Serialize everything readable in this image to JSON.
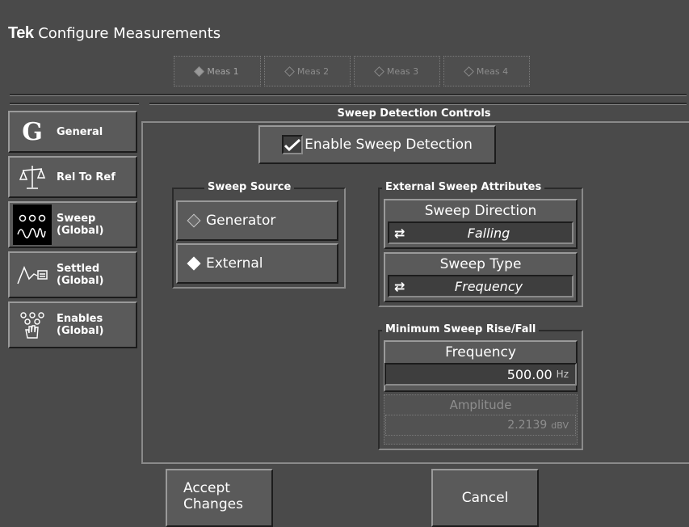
{
  "window": {
    "brand": "Tek",
    "title": "Configure Measurements"
  },
  "meas_tabs": [
    {
      "label": "Meas 1",
      "active": true
    },
    {
      "label": "Meas 2",
      "active": false
    },
    {
      "label": "Meas 3",
      "active": false
    },
    {
      "label": "Meas 4",
      "active": false
    }
  ],
  "section_title": "Sweep Detection Controls",
  "sidebar": {
    "items": [
      {
        "label": "General",
        "icon": "general-icon",
        "selected": false
      },
      {
        "label": "Rel To Ref",
        "icon": "scales-icon",
        "selected": false
      },
      {
        "label": "Sweep\n(Global)",
        "icon": "sweep-icon",
        "selected": true
      },
      {
        "label": "Settled\n(Global)",
        "icon": "settled-icon",
        "selected": false
      },
      {
        "label": "Enables\n(Global)",
        "icon": "enables-icon",
        "selected": false
      }
    ]
  },
  "enable_sweep": {
    "label": "Enable Sweep Detection",
    "checked": true
  },
  "sweep_source": {
    "title": "Sweep Source",
    "options": [
      {
        "label": "Generator",
        "selected": false
      },
      {
        "label": "External",
        "selected": true
      }
    ]
  },
  "external_attributes": {
    "title": "External Sweep Attributes",
    "direction": {
      "label": "Sweep Direction",
      "value": "Falling"
    },
    "type": {
      "label": "Sweep Type",
      "value": "Frequency"
    }
  },
  "min_rise_fall": {
    "title": "Minimum Sweep Rise/Fall",
    "frequency": {
      "label": "Frequency",
      "value": "500.00",
      "unit": "Hz"
    },
    "amplitude": {
      "label": "Amplitude",
      "value": "2.2139",
      "unit": "dBV",
      "enabled": false
    }
  },
  "footer": {
    "accept": "Accept\nChanges",
    "cancel": "Cancel"
  }
}
